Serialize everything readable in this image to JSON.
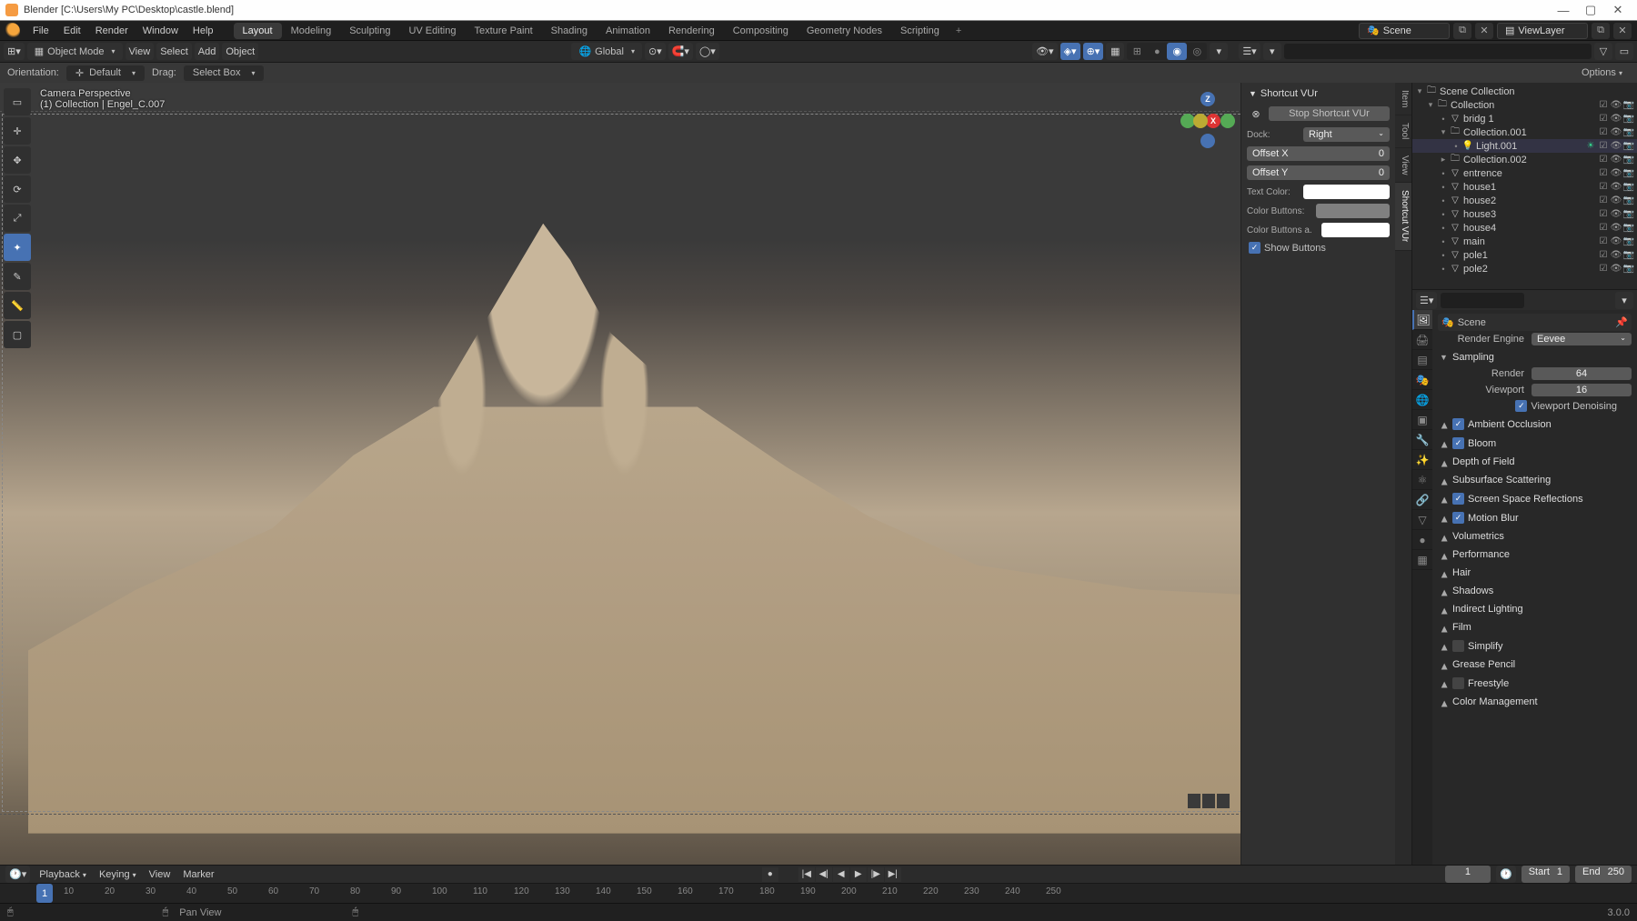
{
  "window": {
    "title": "Blender [C:\\Users\\My PC\\Desktop\\castle.blend]"
  },
  "menubar": {
    "items": [
      "File",
      "Edit",
      "Render",
      "Window",
      "Help"
    ],
    "workspaces": [
      "Layout",
      "Modeling",
      "Sculpting",
      "UV Editing",
      "Texture Paint",
      "Shading",
      "Animation",
      "Rendering",
      "Compositing",
      "Geometry Nodes",
      "Scripting"
    ],
    "active_workspace": "Layout",
    "scene_label": "Scene",
    "viewlayer_label": "ViewLayer"
  },
  "view3d_header": {
    "mode": "Object Mode",
    "menus": [
      "View",
      "Select",
      "Add",
      "Object"
    ],
    "orientation": "Global"
  },
  "orient_bar": {
    "orientation_label": "Orientation:",
    "orientation_value": "Default",
    "drag_label": "Drag:",
    "drag_value": "Select Box",
    "options_label": "Options"
  },
  "viewport": {
    "info_line1": "Camera Perspective",
    "info_line2": "(1) Collection | Engel_C.007"
  },
  "npanel": {
    "tabs": [
      "Item",
      "Tool",
      "View",
      "Shortcut VUr"
    ],
    "active_tab": "Shortcut VUr",
    "panel_title": "Shortcut VUr",
    "stop_button": "Stop Shortcut VUr",
    "dock_label": "Dock:",
    "dock_value": "Right",
    "offset_x_label": "Offset X",
    "offset_x_value": "0",
    "offset_y_label": "Offset Y",
    "offset_y_value": "0",
    "text_color_label": "Text Color:",
    "color_buttons_label": "Color Buttons:",
    "color_buttons_a_label": "Color Buttons a.",
    "show_buttons_label": "Show Buttons",
    "text_color": "#ffffff",
    "color_buttons": "#808080",
    "color_buttons_a": "#ffffff"
  },
  "outliner": {
    "title": "Scene Collection",
    "items": [
      {
        "label": "Collection",
        "indent": 1,
        "icon": "collection",
        "expanded": true
      },
      {
        "label": "bridg 1",
        "indent": 2,
        "icon": "mesh"
      },
      {
        "label": "Collection.001",
        "indent": 2,
        "icon": "collection",
        "expanded": true
      },
      {
        "label": "Light.001",
        "indent": 3,
        "icon": "light",
        "selected": true
      },
      {
        "label": "Collection.002",
        "indent": 2,
        "icon": "collection"
      },
      {
        "label": "entrence",
        "indent": 2,
        "icon": "mesh"
      },
      {
        "label": "house1",
        "indent": 2,
        "icon": "mesh"
      },
      {
        "label": "house2",
        "indent": 2,
        "icon": "mesh"
      },
      {
        "label": "house3",
        "indent": 2,
        "icon": "mesh"
      },
      {
        "label": "house4",
        "indent": 2,
        "icon": "mesh"
      },
      {
        "label": "main",
        "indent": 2,
        "icon": "mesh"
      },
      {
        "label": "pole1",
        "indent": 2,
        "icon": "mesh"
      },
      {
        "label": "pole2",
        "indent": 2,
        "icon": "mesh"
      }
    ]
  },
  "properties": {
    "scene_name": "Scene",
    "render_engine_label": "Render Engine",
    "render_engine_value": "Eevee",
    "sampling_label": "Sampling",
    "render_label": "Render",
    "render_value": "64",
    "viewport_label": "Viewport",
    "viewport_value": "16",
    "viewport_denoise_label": "Viewport Denoising",
    "sections": [
      {
        "label": "Ambient Occlusion",
        "checked": true
      },
      {
        "label": "Bloom",
        "checked": true
      },
      {
        "label": "Depth of Field",
        "checked": false
      },
      {
        "label": "Subsurface Scattering",
        "checked": false
      },
      {
        "label": "Screen Space Reflections",
        "checked": true
      },
      {
        "label": "Motion Blur",
        "checked": true
      },
      {
        "label": "Volumetrics",
        "checked": false
      },
      {
        "label": "Performance",
        "checked": false
      },
      {
        "label": "Hair",
        "checked": false
      },
      {
        "label": "Shadows",
        "checked": false
      },
      {
        "label": "Indirect Lighting",
        "checked": false
      },
      {
        "label": "Film",
        "checked": false
      },
      {
        "label": "Simplify",
        "checked": null
      },
      {
        "label": "Grease Pencil",
        "checked": false
      },
      {
        "label": "Freestyle",
        "checked": null
      },
      {
        "label": "Color Management",
        "checked": false
      }
    ]
  },
  "timeline": {
    "menus": [
      "Playback",
      "Keying",
      "View",
      "Marker"
    ],
    "current_frame": "1",
    "start_label": "Start",
    "start_value": "1",
    "end_label": "End",
    "end_value": "250",
    "ticks": [
      "10",
      "20",
      "30",
      "40",
      "50",
      "60",
      "70",
      "80",
      "90",
      "100",
      "110",
      "120",
      "130",
      "140",
      "150",
      "160",
      "170",
      "180",
      "190",
      "200",
      "210",
      "220",
      "230",
      "240",
      "250"
    ]
  },
  "statusbar": {
    "hint1": "Pan View",
    "version": "3.0.0"
  }
}
